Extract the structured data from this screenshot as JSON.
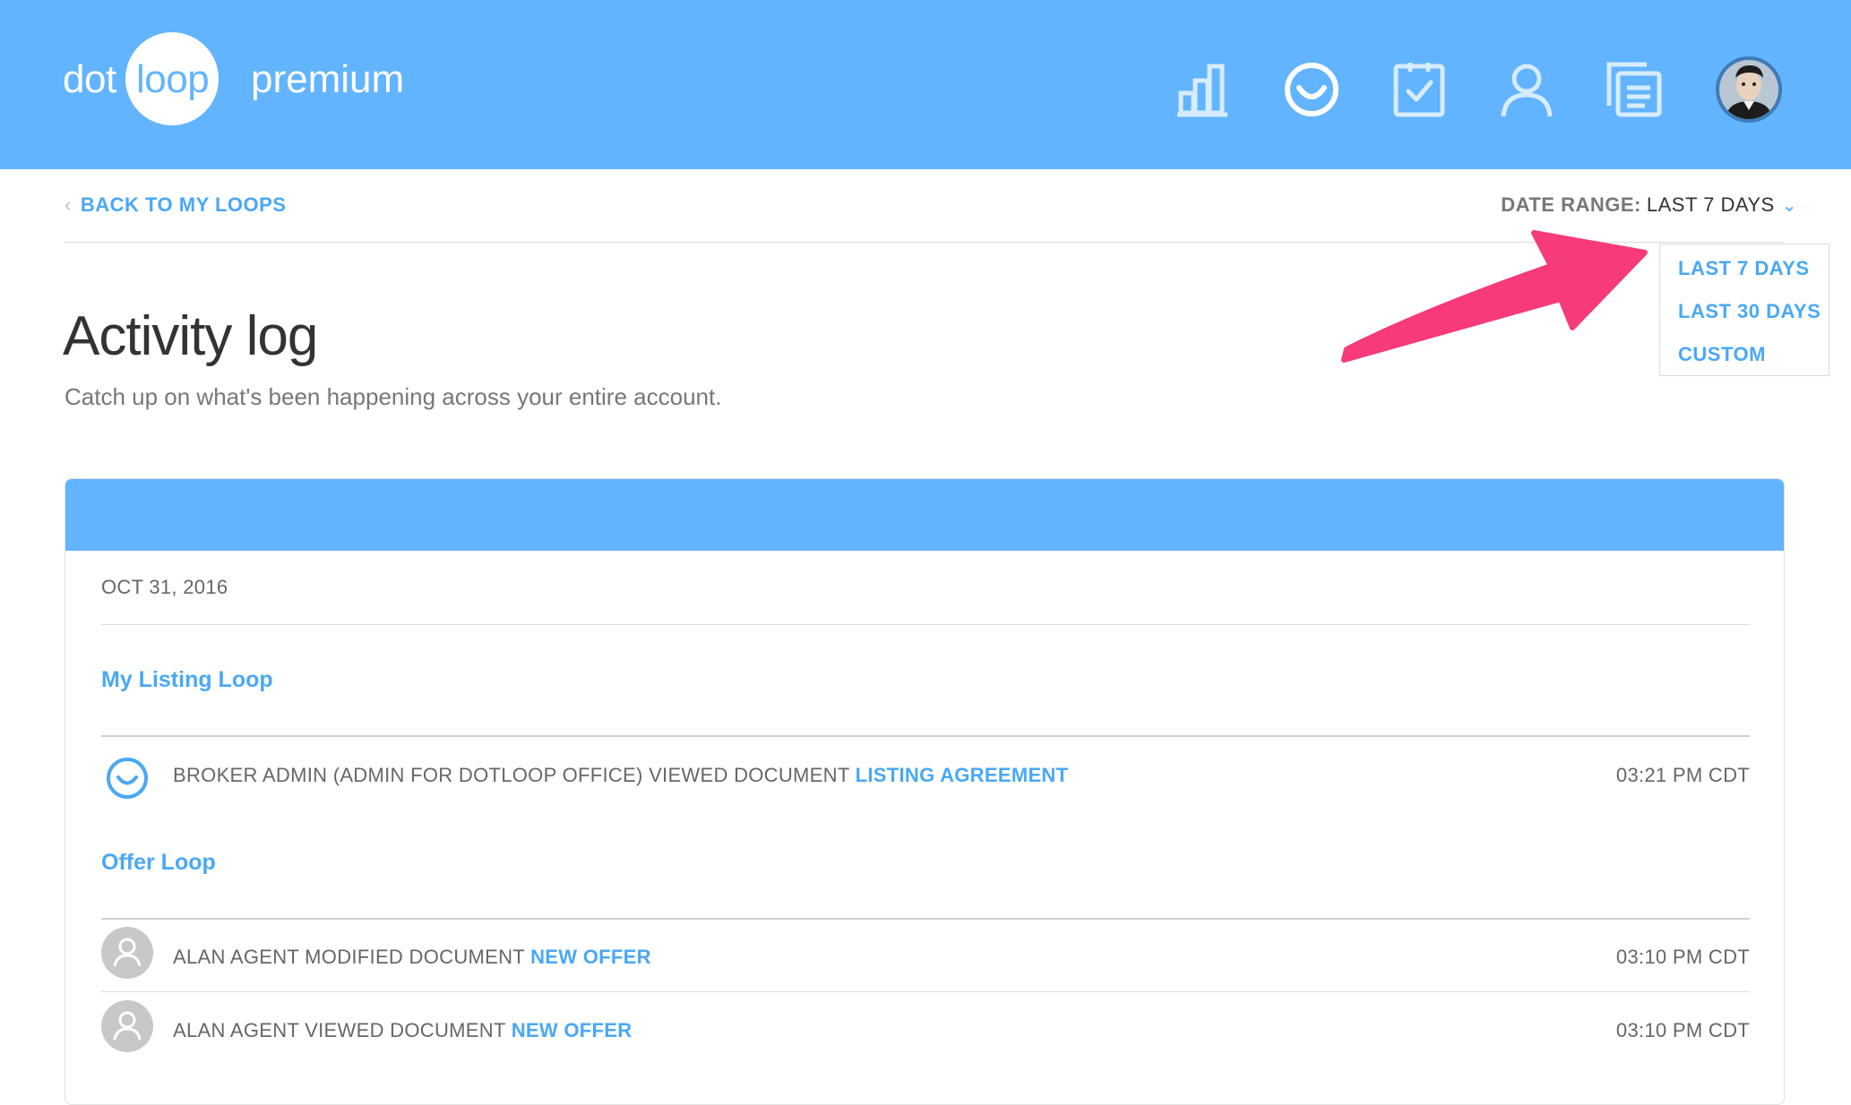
{
  "header": {
    "logo_dot": "dot",
    "logo_loop": "loop",
    "logo_premium": "premium",
    "nav_icons": [
      "bar-chart-icon",
      "smile-loop-icon",
      "task-check-icon",
      "person-icon",
      "documents-icon"
    ],
    "brand_color": "#62b4ff"
  },
  "subbar": {
    "back_label": "BACK TO MY LOOPS",
    "date_range_label": "DATE RANGE:",
    "date_range_value": "LAST 7 DAYS"
  },
  "dropdown": {
    "options": [
      "LAST 7 DAYS",
      "LAST 30 DAYS",
      "CUSTOM"
    ]
  },
  "page": {
    "title": "Activity log",
    "subtitle": "Catch up on what's been happening across your entire account."
  },
  "log": {
    "date": "OCT 31, 2016",
    "loops": [
      {
        "name": "My Listing Loop",
        "activities": [
          {
            "text": "BROKER ADMIN (ADMIN FOR DOTLOOP OFFICE) VIEWED DOCUMENT",
            "document": "LISTING AGREEMENT",
            "time": "03:21 PM CDT",
            "icon": "dotloop-icon"
          }
        ]
      },
      {
        "name": "Offer Loop",
        "activities": [
          {
            "text": "ALAN AGENT MODIFIED DOCUMENT",
            "document": "NEW OFFER",
            "time": "03:10 PM CDT",
            "icon": "user-avatar-icon"
          },
          {
            "text": "ALAN AGENT VIEWED DOCUMENT",
            "document": "NEW OFFER",
            "time": "03:10 PM CDT",
            "icon": "user-avatar-icon"
          }
        ]
      }
    ]
  },
  "annotation": {
    "arrow_color": "#f73a78"
  }
}
